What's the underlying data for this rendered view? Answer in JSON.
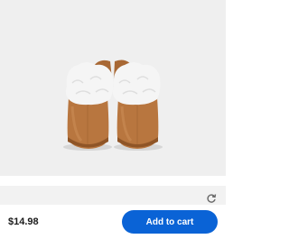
{
  "product": {
    "image_icon": "slipper-pair-image",
    "price": "$14.98"
  },
  "actions": {
    "add_to_cart_label": "Add to cart",
    "refresh_icon": "refresh-icon"
  },
  "colors": {
    "accent": "#0a63d6",
    "image_bg": "#efefef",
    "slipper_leather": "#b8763f",
    "fur": "#f4f4f4"
  }
}
